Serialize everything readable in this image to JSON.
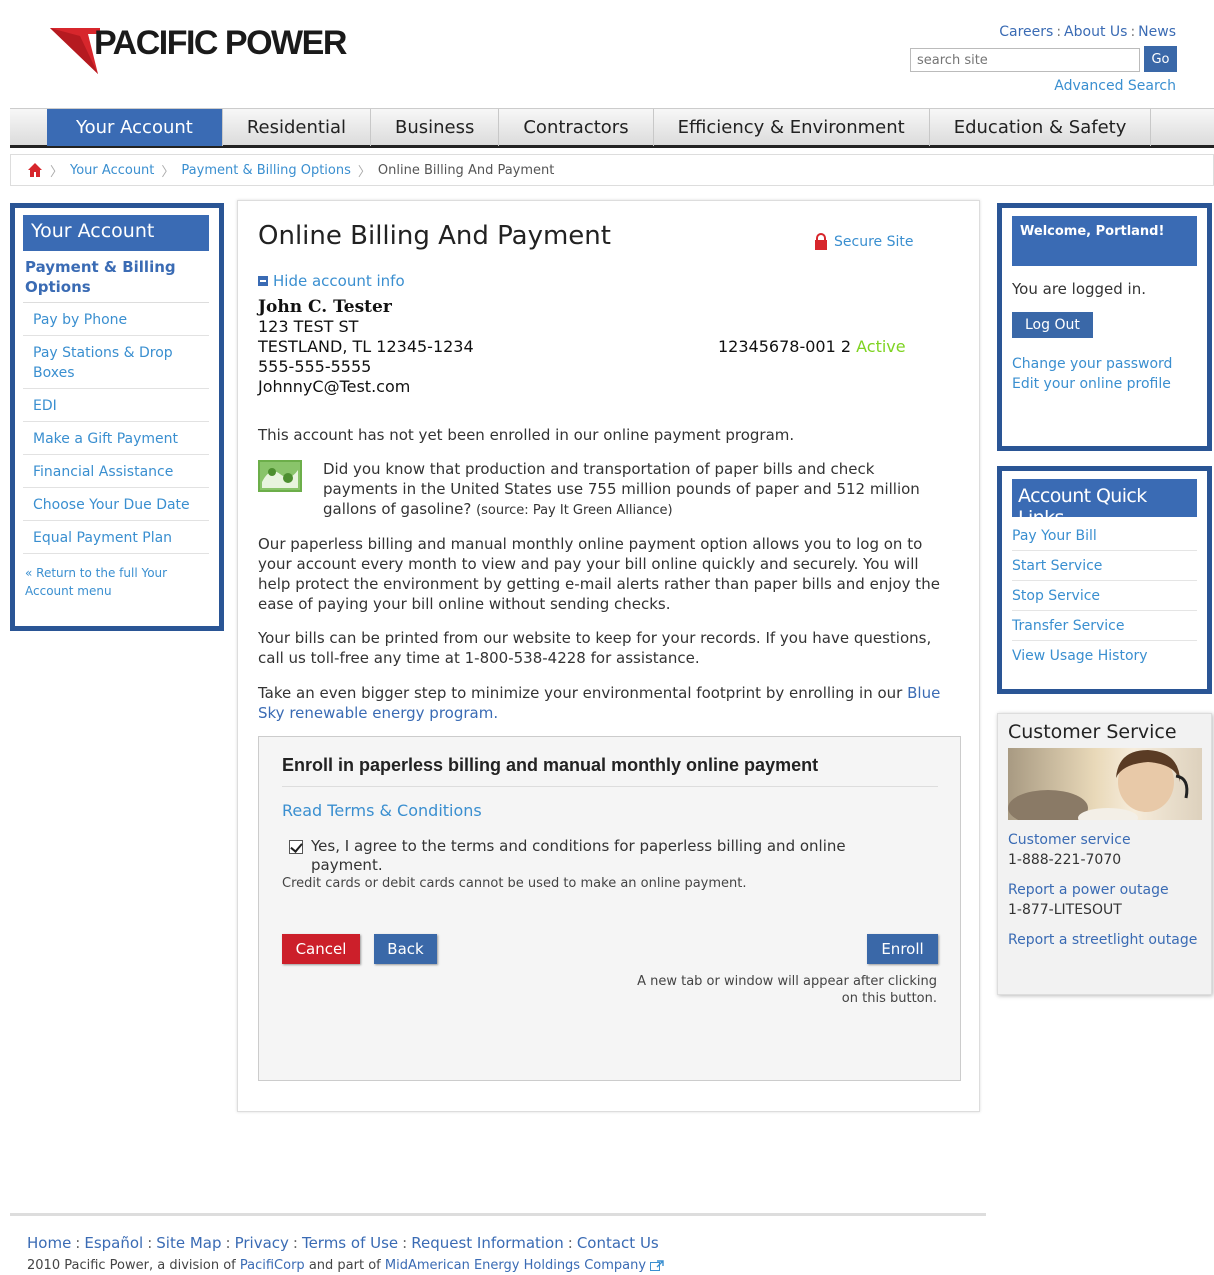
{
  "header": {
    "logo_text": "PACIFIC POWER",
    "top_links": [
      "Careers",
      "About Us",
      "News"
    ],
    "search_placeholder": "search site",
    "go_label": "Go",
    "advanced_search": "Advanced Search"
  },
  "nav": {
    "items": [
      {
        "label": "Your Account",
        "active": true
      },
      {
        "label": "Residential"
      },
      {
        "label": "Business"
      },
      {
        "label": "Contractors"
      },
      {
        "label": "Efficiency & Environment"
      },
      {
        "label": "Education & Safety"
      }
    ]
  },
  "breadcrumb": {
    "items": [
      "Your Account",
      "Payment & Billing Options",
      "Online Billing And Payment"
    ]
  },
  "left_sidebar": {
    "title": "Your Account",
    "subtitle": "Payment & Billing Options",
    "items": [
      "Pay by Phone",
      "Pay Stations & Drop Boxes",
      "EDI",
      "Make a Gift Payment",
      "Financial Assistance",
      "Choose Your Due Date",
      "Equal Payment Plan"
    ],
    "return_link": "« Return to the full Your Account menu"
  },
  "main": {
    "title": "Online Billing And Payment",
    "secure_label": "Secure Site",
    "hide_info": "Hide account info",
    "customer": {
      "name": "John C. Tester",
      "street": "123 TEST ST",
      "city": "TESTLAND, TL 12345-1234",
      "phone": "555-555-5555",
      "email": "JohnnyC@Test.com"
    },
    "account_number": "12345678-001 2",
    "account_status": "Active",
    "not_enrolled": "This account has not yet been enrolled in our online payment program.",
    "tip_text": "Did you know that production and transportation of paper bills and check payments in the United States use 755 million pounds of paper and 512 million gallons of gasoline?",
    "tip_source": "(source: Pay It Green Alliance)",
    "para_paperless": "Our paperless billing and manual monthly online payment option allows you to log on to your account every month to view and pay your bill online quickly and securely. You will help protect the environment by getting e-mail alerts rather than paper bills and enjoy the ease of paying your bill online without sending checks.",
    "para_print": "Your bills can be printed from our website to keep for your records. If you have questions, call us toll-free any time at 1-800-538-4228 for assistance.",
    "para_bluesky_prefix": "Take an even bigger step to minimize your environmental footprint by enrolling in our",
    "bluesky_link": "Blue Sky renewable energy program."
  },
  "enroll": {
    "title": "Enroll in paperless billing and manual monthly online payment",
    "terms_link": "Read Terms & Conditions",
    "agree_label": "Yes, I agree to the terms and conditions for paperless billing and online payment.",
    "agree_checked": true,
    "cc_note": "Credit cards or debit cards cannot be used to make an online payment.",
    "cancel": "Cancel",
    "back": "Back",
    "enroll_btn": "Enroll",
    "window_note": "A new tab or window will appear after clicking on this button."
  },
  "welcome": {
    "greeting": "Welcome, Portland!",
    "status": "You are logged in.",
    "logout": "Log Out",
    "change_password": "Change your password",
    "edit_profile": "Edit your online profile"
  },
  "quick_links": {
    "title": "Account Quick Links",
    "items": [
      "Pay Your Bill",
      "Start Service",
      "Stop Service",
      "Transfer Service",
      "View Usage History"
    ]
  },
  "customer_service": {
    "title": "Customer Service",
    "cs_label": "Customer service",
    "cs_phone": "1-888-221-7070",
    "outage_label": "Report a power outage",
    "outage_phone": "1-877-LITESOUT",
    "streetlight_label": "Report a streetlight outage"
  },
  "footer": {
    "links": [
      "Home",
      "Español",
      "Site Map",
      "Privacy",
      "Terms of Use",
      "Request Information",
      "Contact Us"
    ],
    "copy_prefix": "2010 Pacific Power, a division of",
    "pacificorp": "PacifiCorp",
    "copy_mid": "and part of",
    "midamerican": "MidAmerican Energy Holdings Company"
  },
  "colors": {
    "brand_blue": "#3a6bb4",
    "link_blue": "#3a8fd0",
    "logo_red": "#d7262c",
    "active_green": "#7ed321",
    "cancel_red": "#cc1f2a"
  }
}
